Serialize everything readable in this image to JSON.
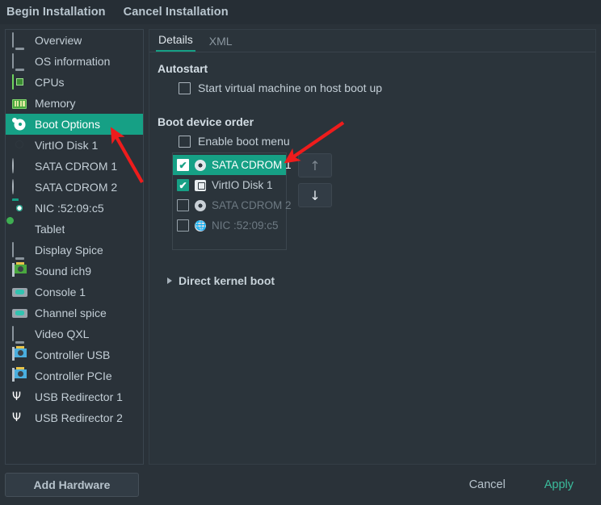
{
  "toolbar": {
    "items": [
      {
        "label": "Begin Installation",
        "name": "begin-installation-button"
      },
      {
        "label": "Cancel Installation",
        "name": "cancel-installation-button"
      }
    ]
  },
  "sidebar": {
    "items": [
      {
        "label": "Overview",
        "icon": "monitor-icon",
        "selected": false
      },
      {
        "label": "OS information",
        "icon": "monitor-icon",
        "selected": false
      },
      {
        "label": "CPUs",
        "icon": "cpu-chip-icon",
        "selected": false
      },
      {
        "label": "Memory",
        "icon": "memory-stick-icon",
        "selected": false
      },
      {
        "label": "Boot Options",
        "icon": "gear-icon",
        "selected": true
      },
      {
        "label": "VirtIO Disk 1",
        "icon": "hard-disk-icon",
        "selected": false
      },
      {
        "label": "SATA CDROM 1",
        "icon": "cdrom-disc-icon",
        "selected": false
      },
      {
        "label": "SATA CDROM 2",
        "icon": "cdrom-disc-icon",
        "selected": false
      },
      {
        "label": "NIC :52:09:c5",
        "icon": "network-card-icon",
        "selected": false
      },
      {
        "label": "Tablet",
        "icon": "tablet-icon",
        "selected": false
      },
      {
        "label": "Display Spice",
        "icon": "monitor-icon",
        "selected": false
      },
      {
        "label": "Sound ich9",
        "icon": "sound-card-icon",
        "selected": false
      },
      {
        "label": "Console 1",
        "icon": "serial-port-icon",
        "selected": false
      },
      {
        "label": "Channel spice",
        "icon": "serial-port-icon",
        "selected": false
      },
      {
        "label": "Video QXL",
        "icon": "monitor-icon",
        "selected": false
      },
      {
        "label": "Controller USB",
        "icon": "usb-controller-icon",
        "selected": false
      },
      {
        "label": "Controller PCIe",
        "icon": "pcie-controller-icon",
        "selected": false
      },
      {
        "label": "USB Redirector 1",
        "icon": "usb-icon",
        "selected": false
      },
      {
        "label": "USB Redirector 2",
        "icon": "usb-icon",
        "selected": false
      }
    ],
    "add_hardware_label": "Add Hardware"
  },
  "main": {
    "tabs": [
      {
        "label": "Details",
        "active": true
      },
      {
        "label": "XML",
        "active": false
      }
    ],
    "autostart": {
      "title": "Autostart",
      "checkbox_label": "Start virtual machine on host boot up",
      "checked": false
    },
    "boot_device_order": {
      "title": "Boot device order",
      "enable_boot_menu_label": "Enable boot menu",
      "enable_boot_menu_checked": false,
      "devices": [
        {
          "label": "SATA CDROM 1",
          "icon": "cdrom-disc-icon",
          "checked": true,
          "selected": true,
          "enabled": true
        },
        {
          "label": "VirtIO Disk 1",
          "icon": "hard-disk-icon",
          "checked": true,
          "selected": false,
          "enabled": true
        },
        {
          "label": "SATA CDROM 2",
          "icon": "cdrom-disc-icon",
          "checked": false,
          "selected": false,
          "enabled": false
        },
        {
          "label": "NIC :52:09:c5",
          "icon": "network-globe-icon",
          "checked": false,
          "selected": false,
          "enabled": false
        }
      ],
      "move_up_label": "↑",
      "move_down_label": "↓"
    },
    "direct_kernel_boot": {
      "label": "Direct kernel boot",
      "expanded": false
    }
  },
  "footer": {
    "cancel_label": "Cancel",
    "apply_label": "Apply"
  },
  "colors": {
    "accent": "#16a085",
    "window_bg": "#2a3239",
    "toolbar_bg": "#262e35",
    "panel_bg": "#2b343b",
    "text": "#c3ced6",
    "annotation": "#ee1c1c"
  },
  "annotations": [
    {
      "name": "arrow-to-boot-options",
      "points_to": "Boot Options"
    },
    {
      "name": "arrow-to-sata-cdrom-1",
      "points_to": "SATA CDROM 1"
    }
  ]
}
